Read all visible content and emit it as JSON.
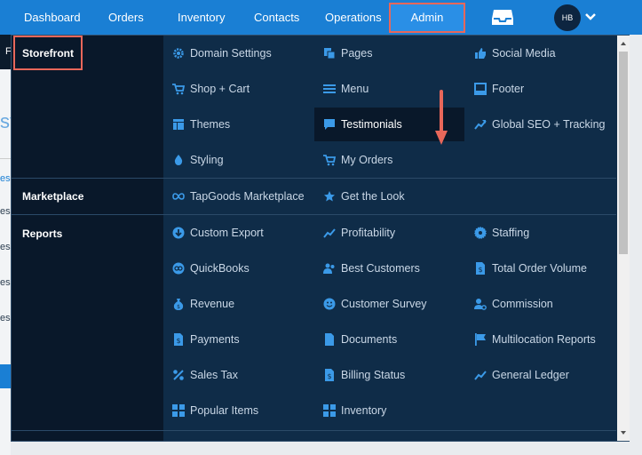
{
  "nav": {
    "items": [
      {
        "label": "Dashboard"
      },
      {
        "label": "Orders"
      },
      {
        "label": "Inventory"
      },
      {
        "label": "Contacts"
      },
      {
        "label": "Operations"
      }
    ],
    "admin_label": "Admin",
    "avatar_initials": "HB"
  },
  "background": {
    "rows": [
      "es",
      "es",
      "es",
      "es",
      "es"
    ],
    "big_text": "st",
    "bar_letter": "F"
  },
  "menu": {
    "sections": {
      "storefront": "Storefront",
      "marketplace": "Marketplace",
      "reports": "Reports"
    },
    "storefront_items": [
      {
        "label": "Domain Settings",
        "icon": "gear-icon"
      },
      {
        "label": "Pages",
        "icon": "pages-icon"
      },
      {
        "label": "Social Media",
        "icon": "thumbs-up-icon"
      },
      {
        "label": "Shop + Cart",
        "icon": "cart-icon"
      },
      {
        "label": "Menu",
        "icon": "menu-icon"
      },
      {
        "label": "Footer",
        "icon": "footer-icon"
      },
      {
        "label": "Themes",
        "icon": "themes-icon"
      },
      {
        "label": "Testimonials",
        "icon": "chat-icon"
      },
      {
        "label": "Global SEO + Tracking",
        "icon": "trend-icon"
      },
      {
        "label": "Styling",
        "icon": "drop-icon"
      },
      {
        "label": "My Orders",
        "icon": "cart-icon"
      }
    ],
    "marketplace_items": [
      {
        "label": "TapGoods Marketplace",
        "icon": "infinity-icon"
      },
      {
        "label": "Get the Look",
        "icon": "star-icon"
      }
    ],
    "reports_items": [
      {
        "label": "Custom Export",
        "icon": "download-icon"
      },
      {
        "label": "Profitability",
        "icon": "trend-icon"
      },
      {
        "label": "Staffing",
        "icon": "badge-icon"
      },
      {
        "label": "QuickBooks",
        "icon": "quickbooks-icon"
      },
      {
        "label": "Best Customers",
        "icon": "users-icon"
      },
      {
        "label": "Total Order Volume",
        "icon": "document-dollar-icon"
      },
      {
        "label": "Revenue",
        "icon": "money-bag-icon"
      },
      {
        "label": "Customer Survey",
        "icon": "smile-icon"
      },
      {
        "label": "Commission",
        "icon": "user-gear-icon"
      },
      {
        "label": "Payments",
        "icon": "document-dollar-icon"
      },
      {
        "label": "Documents",
        "icon": "document-icon"
      },
      {
        "label": "Multilocation Reports",
        "icon": "flag-icon"
      },
      {
        "label": "Sales Tax",
        "icon": "percent-icon"
      },
      {
        "label": "Billing Status",
        "icon": "document-dollar-icon"
      },
      {
        "label": "General Ledger",
        "icon": "trend-icon"
      },
      {
        "label": "Popular Items",
        "icon": "grid-icon"
      },
      {
        "label": "Inventory",
        "icon": "grid-icon"
      }
    ]
  },
  "colors": {
    "nav_blue": "#1a7fd4",
    "menu_bg": "#0f2c48",
    "sidebar_bg": "#09182a",
    "icon_blue": "#3b9ae8",
    "annotation_red": "#e8675a"
  }
}
